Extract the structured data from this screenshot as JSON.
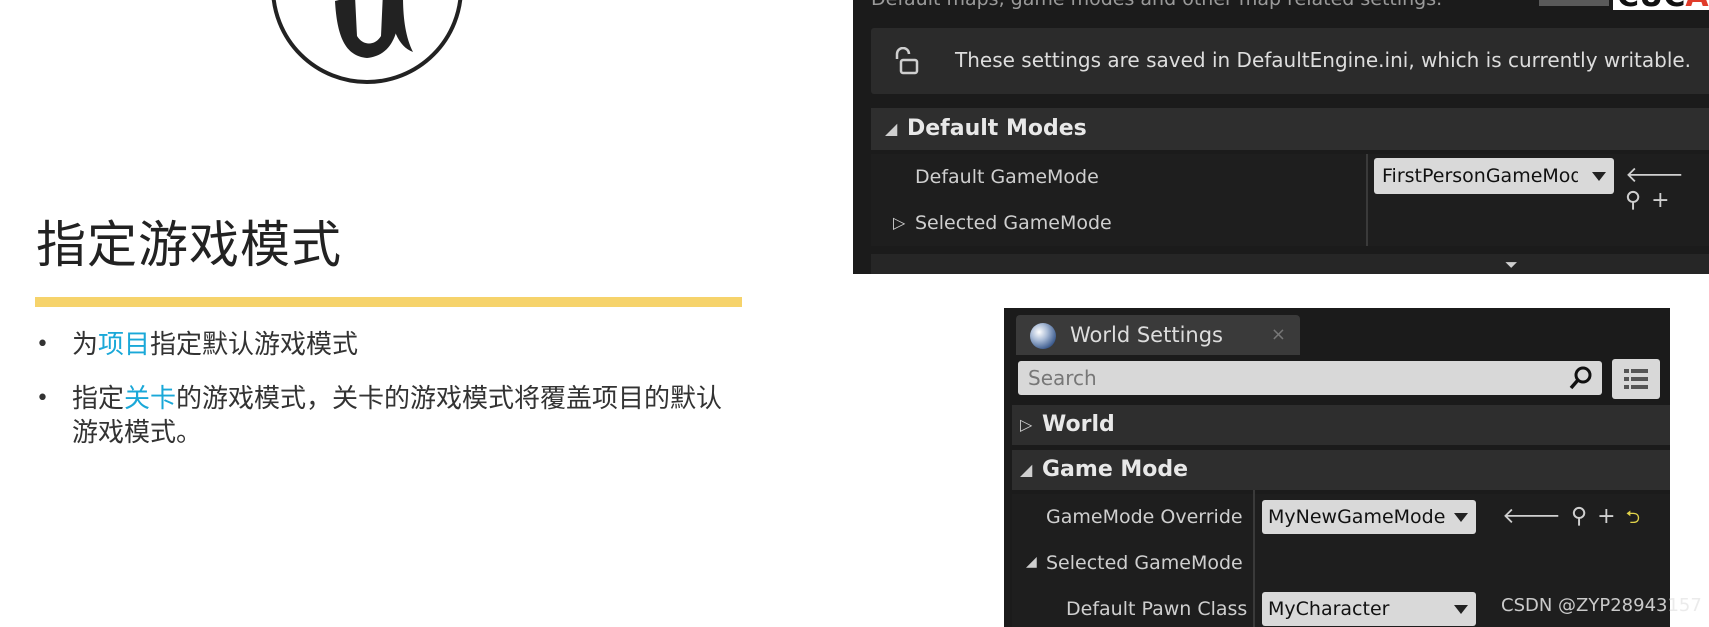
{
  "slide": {
    "title": "指定游戏模式",
    "bullets": [
      {
        "pre": "为",
        "highlight": "项目",
        "post": "指定默认游戏模式"
      },
      {
        "pre": "指定",
        "highlight": "关卡",
        "post": "的游戏模式，关卡的游戏模式将覆盖项目的默认游戏模式。"
      }
    ],
    "colors": {
      "accent_bar": "#f6d36b",
      "highlight": "#1aa8d8"
    }
  },
  "project_settings": {
    "description": "Default maps, game modes and other map related settings.",
    "logo_fragment": "CUC",
    "logo_fragment_red": "A",
    "notice": "These settings are saved in DefaultEngine.ini, which is currently writable.",
    "section_title": "Default Modes",
    "rows": {
      "default_gamemode_label": "Default GameMode",
      "default_gamemode_value": "FirstPersonGameMode",
      "selected_gamemode_label": "Selected GameMode"
    }
  },
  "world_settings": {
    "tab_title": "World Settings",
    "search_placeholder": "Search",
    "sections": {
      "world": "World",
      "game_mode": "Game Mode"
    },
    "rows": {
      "gamemode_override_label": "GameMode Override",
      "gamemode_override_value": "MyNewGameMode",
      "selected_gamemode_label": "Selected GameMode",
      "default_pawn_label": "Default Pawn Class",
      "default_pawn_value": "MyCharacter"
    }
  },
  "watermark": "CSDN @ZYP28943157"
}
